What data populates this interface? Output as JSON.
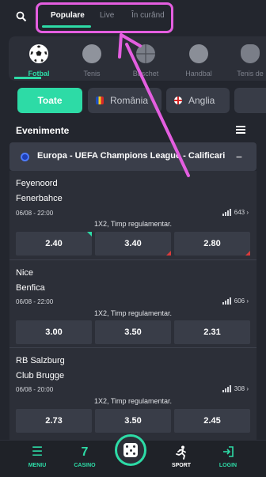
{
  "header": {
    "tabs": [
      {
        "label": "Populare",
        "active": true
      },
      {
        "label": "Live",
        "active": false
      },
      {
        "label": "În curând",
        "active": false
      }
    ]
  },
  "sports": [
    {
      "label": "Fotbal",
      "icon": "soccer-ball-icon",
      "active": true
    },
    {
      "label": "Tenis",
      "icon": "tennis-ball-icon",
      "active": false
    },
    {
      "label": "Baschet",
      "icon": "basketball-icon",
      "active": false
    },
    {
      "label": "Handbal",
      "icon": "handball-icon",
      "active": false
    },
    {
      "label": "Tenis de",
      "icon": "table-tennis-icon",
      "active": false
    }
  ],
  "filters": {
    "all": "Toate",
    "romania": "România",
    "england": "Anglia"
  },
  "events_title": "Evenimente",
  "league": {
    "name": "Europa  -  UEFA Champions League - Calificari",
    "collapse": "−"
  },
  "events": [
    {
      "home": "Feyenoord",
      "away": "Fenerbahce",
      "datetime": "06/08 - 22:00",
      "markets_count": "643",
      "market": "1X2, Timp regulamentar.",
      "odds": [
        "2.40",
        "3.40",
        "2.80"
      ]
    },
    {
      "home": "Nice",
      "away": "Benfica",
      "datetime": "06/08 - 22:00",
      "markets_count": "606",
      "market": "1X2, Timp regulamentar.",
      "odds": [
        "3.00",
        "3.50",
        "2.31"
      ]
    },
    {
      "home": "RB Salzburg",
      "away": "Club Brugge",
      "datetime": "06/08 - 20:00",
      "markets_count": "308",
      "market": "1X2, Timp regulamentar.",
      "odds": [
        "2.73",
        "3.50",
        "2.45"
      ]
    }
  ],
  "bottom_nav": {
    "menu": "MENIU",
    "casino": "CASINO",
    "sport": "SPORT",
    "login": "LOGIN"
  },
  "colors": {
    "accent": "#2ddba6",
    "background": "#23262e",
    "annotation": "#e45ee0"
  }
}
